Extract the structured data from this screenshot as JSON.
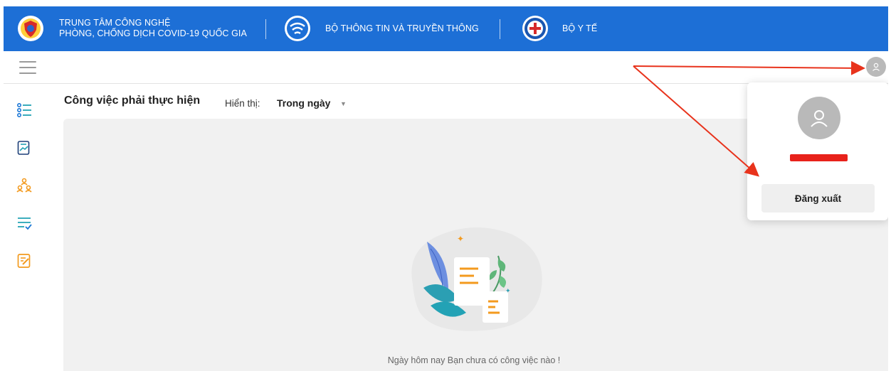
{
  "header": {
    "org_line1": "TRUNG TÂM CÔNG NGHỆ",
    "org_line2": "PHÒNG, CHỐNG DỊCH COVID-19 QUỐC GIA",
    "ministry1": "BỘ THÔNG TIN VÀ TRUYỀN THÔNG",
    "ministry2": "BỘ Y TẾ",
    "color": "#1d6fd6"
  },
  "sidebar": {
    "items": [
      {
        "icon": "list-icon"
      },
      {
        "icon": "report-icon"
      },
      {
        "icon": "people-tree-icon"
      },
      {
        "icon": "checklist-icon"
      },
      {
        "icon": "edit-document-icon"
      }
    ]
  },
  "main": {
    "title": "Công việc phải thực hiện",
    "filter_label": "Hiển thị:",
    "filter_value": "Trong ngày",
    "empty_message": "Ngày hôm nay Bạn chưa có công việc nào !"
  },
  "user_menu": {
    "logout_label": "Đăng xuất"
  },
  "colors": {
    "annotation_arrow": "#e8331c",
    "icon_blue": "#1d78d6",
    "icon_orange": "#f39a1e",
    "icon_teal": "#23a2b5"
  }
}
